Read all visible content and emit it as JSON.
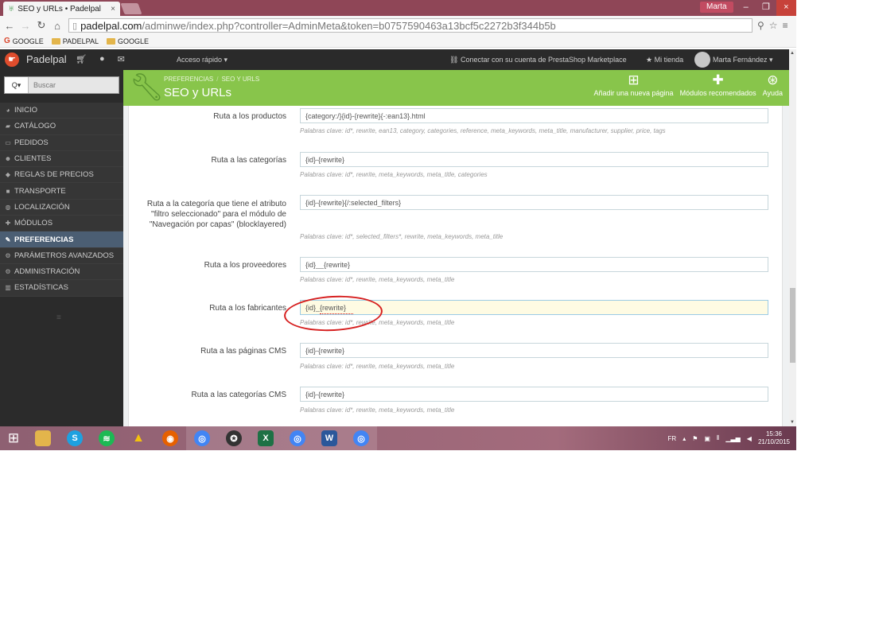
{
  "browser": {
    "tab_title": "SEO y URLs • Padelpal",
    "tab_close": "×",
    "window_user": "Marta",
    "win_minimize": "–",
    "win_maximize": "❐",
    "win_close": "×",
    "url_host": "padelpal.com",
    "url_path": "/adminwe/index.php?controller=AdminMeta&token=b0757590463a13bcf5c2272b3f344b5b",
    "bookmarks": [
      {
        "label": "GOOGLE",
        "icon": "google-icon"
      },
      {
        "label": "PADELPAL",
        "icon": "folder-icon"
      },
      {
        "label": "GOOGLE",
        "icon": "folder-icon"
      }
    ]
  },
  "header": {
    "shop_name": "Padelpal",
    "quick_access": "Acceso rápido ▾",
    "marketplace": "Conectar con su cuenta de PrestaShop Marketplace",
    "my_shop": "Mi tienda",
    "user_name": "Marta Fernández ▾"
  },
  "sidebar": {
    "search_button": "Q▾",
    "search_placeholder": "Buscar",
    "items": [
      {
        "label": "INICIO",
        "icon": "dashboard-icon",
        "active": false
      },
      {
        "label": "CATÁLOGO",
        "icon": "catalog-icon",
        "active": false
      },
      {
        "label": "PEDIDOS",
        "icon": "orders-icon",
        "active": false
      },
      {
        "label": "CLIENTES",
        "icon": "customers-icon",
        "active": false
      },
      {
        "label": "REGLAS DE PRECIOS",
        "icon": "price-rules-icon",
        "active": false
      },
      {
        "label": "TRANSPORTE",
        "icon": "truck-icon",
        "active": false
      },
      {
        "label": "LOCALIZACIÓN",
        "icon": "globe-icon",
        "active": false
      },
      {
        "label": "MÓDULOS",
        "icon": "puzzle-icon",
        "active": false
      },
      {
        "label": "PREFERENCIAS",
        "icon": "wrench-icon",
        "active": true
      },
      {
        "label": "PARÁMETROS AVANZADOS",
        "icon": "cogs-icon",
        "active": false
      },
      {
        "label": "ADMINISTRACIÓN",
        "icon": "gear-icon",
        "active": false
      },
      {
        "label": "ESTADÍSTICAS",
        "icon": "bar-chart-icon",
        "active": false
      }
    ]
  },
  "page": {
    "breadcrumb": [
      "PREFERENCIAS",
      "SEO Y URLS"
    ],
    "title": "SEO y URLs",
    "actions": [
      {
        "label": "Añadir una nueva página",
        "icon": "plus-square-icon"
      },
      {
        "label": "Módulos recomendados",
        "icon": "puzzle-icon"
      },
      {
        "label": "Ayuda",
        "icon": "lifebuoy-icon"
      }
    ]
  },
  "form": {
    "fields": [
      {
        "label": "Ruta a los productos",
        "value": "{category:/}{id}-{rewrite}{-:ean13}.html",
        "help": "Palabras clave: id*, rewrite, ean13, category, categories, reference, meta_keywords, meta_title, manufacturer, supplier, price, tags"
      },
      {
        "label": "Ruta a las categorías",
        "value": "{id}-{rewrite}",
        "help": "Palabras clave: id*, rewrite, meta_keywords, meta_title, categories"
      },
      {
        "label": "Ruta a la categoría que tiene el atributo \"filtro seleccionado\" para el módulo de \"Navegación por capas\" (blocklayered)",
        "value": "{id}-{rewrite}{/:selected_filters}",
        "help": "Palabras clave: id*, selected_filters*, rewrite, meta_keywords, meta_title"
      },
      {
        "label": "Ruta a los proveedores",
        "value": "{id}__{rewrite}",
        "help": "Palabras clave: id*, rewrite, meta_keywords, meta_title"
      },
      {
        "label": "Ruta a los fabricantes",
        "value": "{id}_{rewrite}",
        "help": "Palabras clave: id*, rewrite, meta_keywords, meta_title"
      },
      {
        "label": "Ruta a las páginas CMS",
        "value": "{id}-{rewrite}",
        "help": "Palabras clave: id*, rewrite, meta_keywords, meta_title"
      },
      {
        "label": "Ruta a las categorías CMS",
        "value": "{id}-{rewrite}",
        "help": "Palabras clave: id*, rewrite, meta_keywords, meta_title"
      }
    ]
  },
  "taskbar": {
    "language": "FR",
    "time": "15:36",
    "date": "21/10/2015"
  },
  "colors": {
    "accent_green": "#88c54b",
    "sidebar_dark": "#2b2b2b",
    "active_menu": "#4b5e73",
    "annotation_red": "#d61f1f"
  }
}
